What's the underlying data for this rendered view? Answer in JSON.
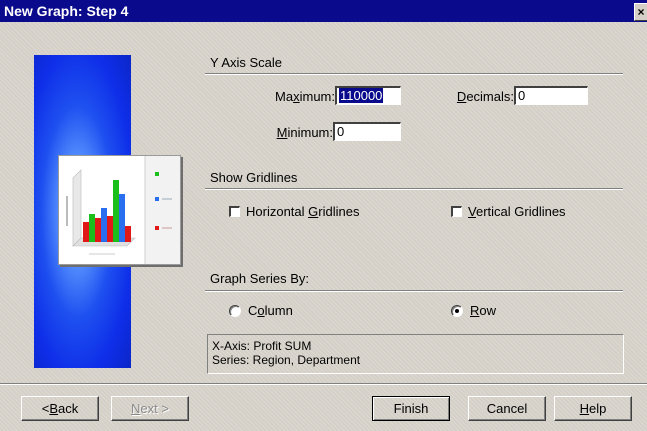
{
  "window": {
    "title": "New Graph: Step 4",
    "close_glyph": "×"
  },
  "y_axis": {
    "heading": "Y Axis Scale",
    "maximum_label_pre": "Ma",
    "maximum_label_u": "x",
    "maximum_label_post": "imum:",
    "maximum_value": "110000",
    "minimum_label_u": "M",
    "minimum_label_post": "inimum:",
    "minimum_value": "0",
    "decimals_label_u": "D",
    "decimals_label_post": "ecimals:",
    "decimals_value": "0"
  },
  "gridlines": {
    "heading": "Show Gridlines",
    "horizontal_pre": "Horizontal ",
    "horizontal_u": "G",
    "horizontal_post": "ridlines",
    "horizontal_checked": false,
    "vertical_u": "V",
    "vertical_post": "ertical Gridlines",
    "vertical_checked": false
  },
  "series": {
    "heading": "Graph Series By:",
    "column_pre": "C",
    "column_u": "o",
    "column_post": "lumn",
    "row_u": "R",
    "row_post": "ow",
    "selected": "row"
  },
  "summary": {
    "line1": "X-Axis: Profit SUM",
    "line2": "Series: Region, Department"
  },
  "buttons": {
    "back_pre": "< ",
    "back_u": "B",
    "back_post": "ack",
    "next_pre": "",
    "next_u": "N",
    "next_post": "ext >",
    "finish": "Finish",
    "cancel": "Cancel",
    "help_u": "H",
    "help_post": "elp"
  },
  "preview_chart": {
    "icon": "bar-chart-preview-icon",
    "colors": {
      "green": "#1bbf1b",
      "blue": "#2a6ef0",
      "red": "#e01818",
      "background": "#0c26c8"
    }
  }
}
